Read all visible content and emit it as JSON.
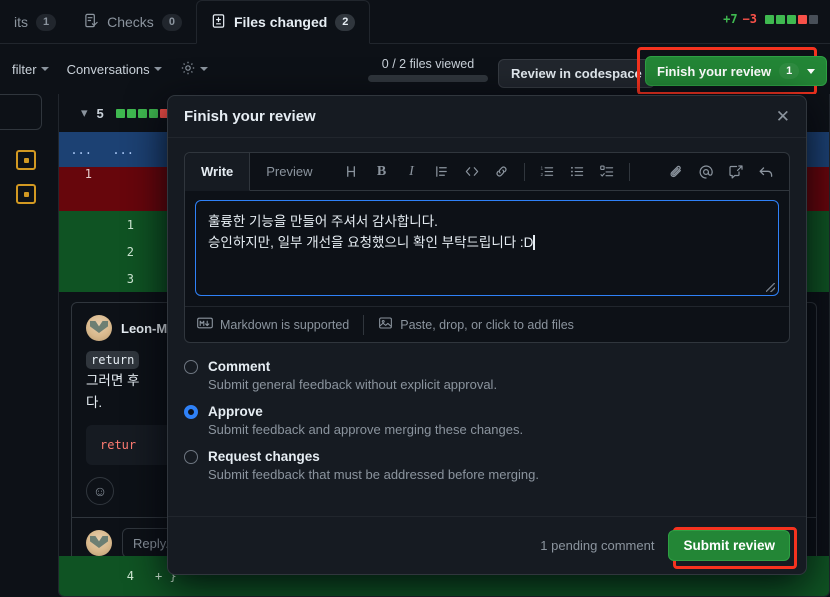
{
  "page": {
    "tabs": [
      {
        "label": "its",
        "count": "1",
        "icon": "commit-icon",
        "active": false
      },
      {
        "label": "Checks",
        "count": "0",
        "icon": "checklist-icon",
        "active": false
      },
      {
        "label": "Files changed",
        "count": "2",
        "icon": "file-diff-icon",
        "active": true
      }
    ],
    "diffstat": {
      "additions": "+7",
      "deletions": "−3",
      "blocks": [
        "#3fb950",
        "#3fb950",
        "#3fb950",
        "#f85149",
        "#484f58"
      ]
    },
    "subbar": {
      "filter_label": "filter",
      "conversations_label": "Conversations",
      "settings_icon": "gear-icon",
      "files_viewed": "0 / 2 files viewed",
      "codespace_label": "Review in codespace",
      "finish_label": "Finish your review",
      "finish_count": "1"
    },
    "diff": {
      "collapsed_count": "5",
      "hunk_left": "...",
      "hunk_right": "...",
      "deleted_line_no": "1",
      "added_line_nos": [
        "1",
        "2",
        "3"
      ],
      "bottom_add_no": "4",
      "bottom_add_text": "+ }"
    },
    "thread": {
      "author": "Leon-M",
      "code_chip": "return",
      "body_line1": "그러면 후",
      "body_line2": "다.",
      "code_snippet": "retur",
      "reaction_icon": "emoji-smile-icon",
      "reply_placeholder": "Reply."
    }
  },
  "modal": {
    "title": "Finish your review",
    "close_icon": "close-icon",
    "editor": {
      "tabs": [
        {
          "label": "Write",
          "active": true
        },
        {
          "label": "Preview",
          "active": false
        }
      ],
      "toolbar_icons": [
        "heading-icon",
        "bold-icon",
        "italic-icon",
        "quote-icon",
        "code-icon",
        "link-icon",
        "ordered-list-icon",
        "unordered-list-icon",
        "task-list-icon",
        "attachment-icon",
        "mention-icon",
        "saved-reply-icon",
        "reply-icon"
      ],
      "value_line1": "훌륭한 기능을 만들어 주셔서 감사합니다.",
      "value_line2": "승인하지만, 일부 개선을 요청했으니 확인 부탁드립니다 :D",
      "markdown_hint": "Markdown is supported",
      "markdown_icon": "markdown-icon",
      "attach_hint": "Paste, drop, or click to add files",
      "attach_icon": "image-icon"
    },
    "options": [
      {
        "label": "Comment",
        "desc": "Submit general feedback without explicit approval.",
        "selected": false
      },
      {
        "label": "Approve",
        "desc": "Submit feedback and approve merging these changes.",
        "selected": true
      },
      {
        "label": "Request changes",
        "desc": "Submit feedback that must be addressed before merging.",
        "selected": false
      }
    ],
    "footer": {
      "pending_text": "1 pending comment",
      "submit_label": "Submit review"
    }
  },
  "colors": {
    "accent_green": "#238636",
    "accent_blue": "#2f81f7",
    "highlight_red": "#f5331f",
    "addition_bg": "#0f5323",
    "deletion_bg": "#67060c",
    "hunk_bg": "#1c4173"
  }
}
